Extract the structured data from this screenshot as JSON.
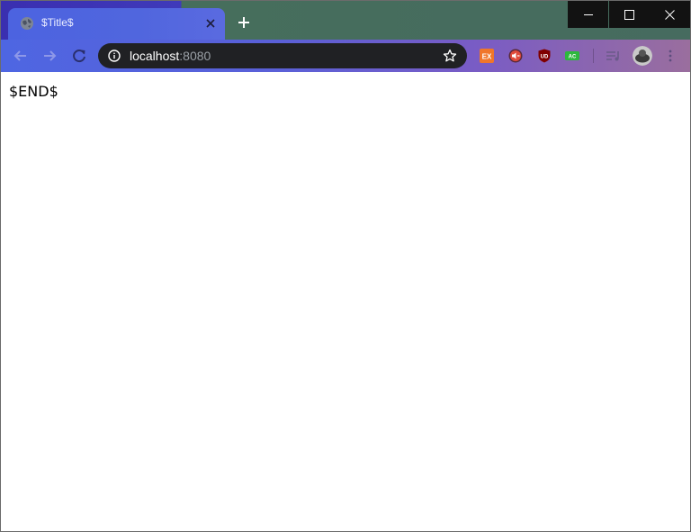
{
  "colors": {
    "accent": "#5066de",
    "omnibox_bg": "#202124",
    "window_controls_bg": "#121212"
  },
  "tab": {
    "title": "$Title$",
    "favicon_icon": "globe-icon",
    "close_icon": "close-icon"
  },
  "new_tab_icon": "plus-icon",
  "window_controls": [
    "minimize-icon",
    "maximize-icon",
    "close-icon"
  ],
  "toolbar": {
    "back_icon": "arrow-left-icon",
    "forward_icon": "arrow-right-icon",
    "reload_icon": "reload-icon"
  },
  "omnibox": {
    "info_icon": "info-icon",
    "host": "localhost",
    "port": ":8080",
    "bookmark_icon": "star-icon"
  },
  "extensions": [
    {
      "label": "EX",
      "color": "#f0762a"
    },
    {
      "label": "",
      "icon": "mute-icon",
      "color": "#e04a3a"
    },
    {
      "label": "UD",
      "color": "#800000"
    },
    {
      "label": "AC",
      "color": "#2db83d"
    }
  ],
  "page": {
    "body_text": "$END$"
  }
}
